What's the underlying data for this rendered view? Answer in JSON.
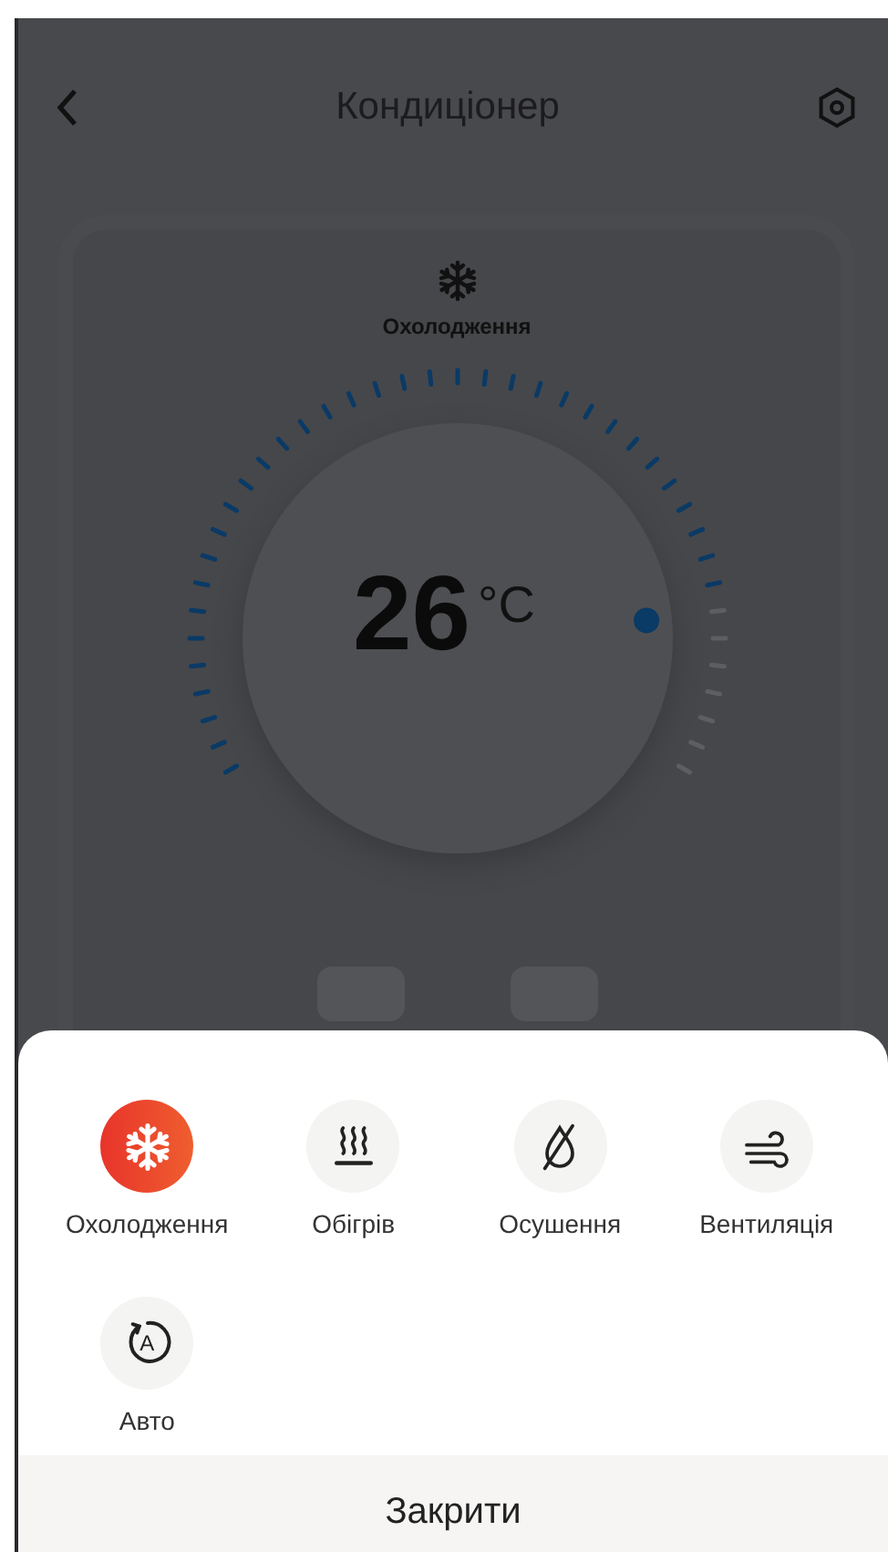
{
  "header": {
    "title": "Кондиціонер"
  },
  "card": {
    "mode_label": "Охолодження",
    "temperature": "26",
    "unit": "°C",
    "level": 0.84
  },
  "mode_sheet": {
    "modes": [
      {
        "kind": "cool",
        "label": "Охолодження",
        "selected": true
      },
      {
        "kind": "heat",
        "label": "Обігрів",
        "selected": false
      },
      {
        "kind": "dry",
        "label": "Осушення",
        "selected": false
      },
      {
        "kind": "fan",
        "label": "Вентиляція",
        "selected": false
      },
      {
        "kind": "auto",
        "label": "Авто",
        "selected": false,
        "icon_letter": "A"
      }
    ],
    "close_button": "Закрити"
  }
}
